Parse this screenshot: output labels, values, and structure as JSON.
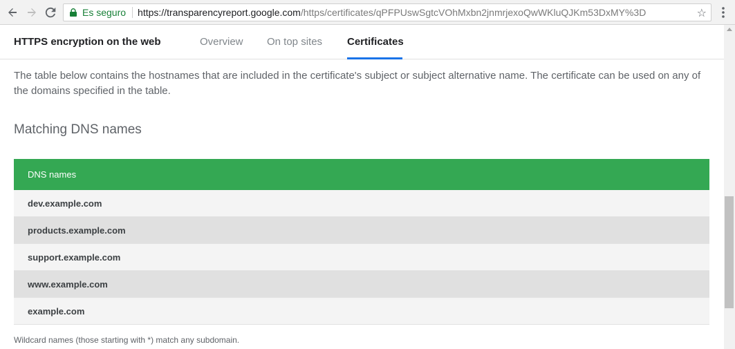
{
  "browser": {
    "back_icon": "arrow-left-icon",
    "forward_icon": "arrow-right-icon",
    "reload_icon": "reload-icon",
    "secure_label": "Es seguro",
    "url_host": "https://transparencyreport.google.com",
    "url_path": "/https/certificates/qPFPUswSgtcVOhMxbn2jnmrjexoQwWKluQJKm53DxMY%3D",
    "bookmark_icon": "star-icon",
    "menu_icon": "more-vert-icon",
    "secure_color": "#188038"
  },
  "header": {
    "title": "HTTPS encryption on the web",
    "tabs": [
      {
        "label": "Overview"
      },
      {
        "label": "On top sites"
      },
      {
        "label": "Certificates"
      }
    ],
    "active_tab": "Certificates",
    "accent_color": "#1a73e8"
  },
  "content": {
    "intro": "The table below contains the hostnames that are included in the certificate's subject or subject alternative name. The certificate can be used on any of the domains specified in the table.",
    "section_title": "Matching DNS names",
    "table": {
      "header": "DNS names",
      "header_color": "#34a853",
      "rows": [
        "dev.example.com",
        "products.example.com",
        "support.example.com",
        "www.example.com",
        "example.com"
      ]
    },
    "footnote": "Wildcard names (those starting with *) match any subdomain."
  }
}
